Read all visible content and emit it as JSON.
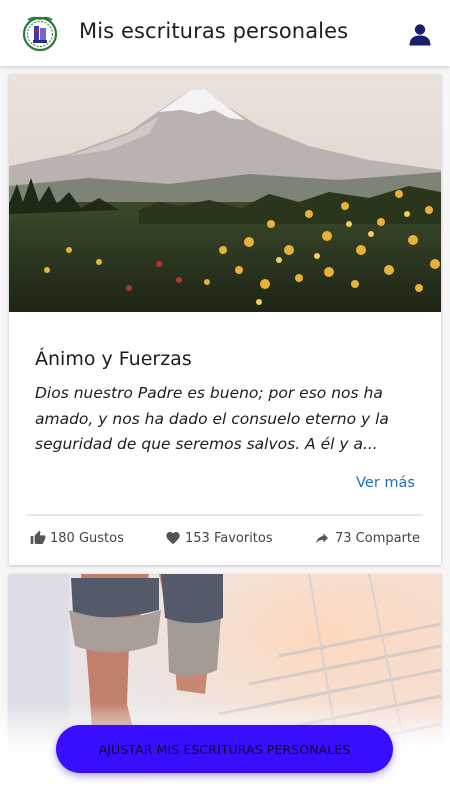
{
  "header": {
    "title": "Mis escrituras personales",
    "logo_icon": "church-emblem-logo",
    "user_icon": "user-profile-icon"
  },
  "feed": {
    "cards": [
      {
        "image": "mountain-flowers-landscape",
        "title": "Ánimo y Fuerzas",
        "excerpt": "Dios nuestro Padre es bueno; por eso nos ha amado, y nos ha dado el consuelo eterno y la seguridad de que seremos salvos. A él y a...",
        "read_more": "Ver más",
        "stats": {
          "likes": "180 Gustos",
          "favorites": "153 Favoritos",
          "shares": "73 Comparte"
        }
      },
      {
        "image": "person-walking-stairs"
      }
    ]
  },
  "fab": {
    "label": "AJUSTAR MIS ESCRITURAS PERSONALES"
  },
  "colors": {
    "accent": "#3a0dff",
    "link": "#1f6fc5",
    "user_icon": "#1a1f6b"
  }
}
